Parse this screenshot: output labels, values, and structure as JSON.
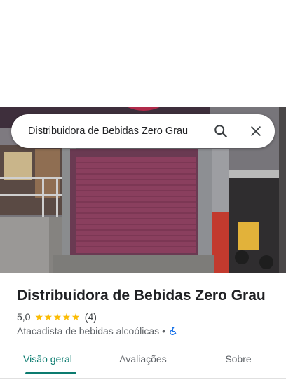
{
  "search": {
    "query": "Distribuidora de Bebidas Zero Grau",
    "search_icon": "search-icon",
    "close_icon": "close-icon"
  },
  "place": {
    "name": "Distribuidora de Bebidas Zero Grau",
    "rating": "5,0",
    "stars": 5,
    "review_count": "(4)",
    "category": "Atacadista de bebidas alcoólicas",
    "separator": "•",
    "accessibility_icon": "wheelchair-icon"
  },
  "tabs": [
    {
      "label": "Visão geral",
      "active": true
    },
    {
      "label": "Avaliações",
      "active": false
    },
    {
      "label": "Sobre",
      "active": false
    }
  ],
  "colors": {
    "accent": "#0b7b6f",
    "star": "#fbbc04",
    "accessibility": "#1a73e8",
    "shutter": "#8a3f5e"
  }
}
